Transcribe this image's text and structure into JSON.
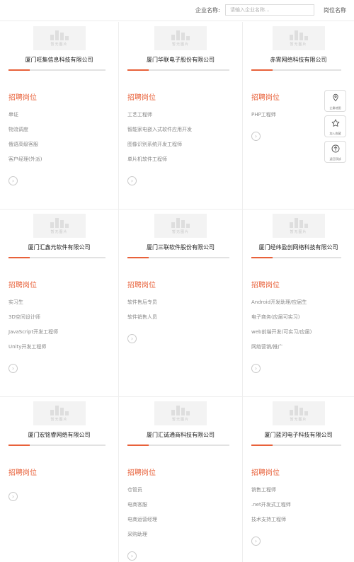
{
  "search": {
    "company_label": "企业名称:",
    "company_placeholder": "请输入企业名称...",
    "position_label": "岗位名称"
  },
  "section_title": "招聘岗位",
  "logo_text": "暂无图片",
  "companies": [
    {
      "name": "厦门旺集信息科技有限公司",
      "jobs": [
        "串证",
        "物流调度",
        "俄语高级客服",
        "客户经理(外派)"
      ]
    },
    {
      "name": "厦门华联电子股份有限公司",
      "jobs": [
        "工艺工程师",
        "智能家电嵌入式软件应用开发",
        "图像识别系统开发工程师",
        "单片机软件工程师"
      ]
    },
    {
      "name": "赤霄网络科技有限公司",
      "jobs": [
        "PHP工程师"
      ]
    },
    {
      "name": "厦门汇鑫元软件有限公司",
      "jobs": [
        "实习生",
        "3D空间设计师",
        "JavaScript开发工程师",
        "Unity开发工程师"
      ]
    },
    {
      "name": "厦门三联软件股份有限公司",
      "jobs": [
        "软件售后专员",
        "软件销售人员"
      ]
    },
    {
      "name": "厦门经纬盈创网络科技有限公司",
      "jobs": [
        "Android开发助理/应届生",
        "电子商务(应届可实习)",
        "web前端开发(可实习/应届)",
        "网络营销/推广"
      ]
    },
    {
      "name": "厦门宏铭睿网络有限公司",
      "jobs": []
    },
    {
      "name": "厦门汇诚通商科技有限公司",
      "jobs": [
        "仓管员",
        "电商客服",
        "电商运营经理",
        "采购助理"
      ]
    },
    {
      "name": "厦门蓝河电子科技有限公司",
      "jobs": [
        "销售工程师",
        ".net开发式工程师",
        "技术支持工程师"
      ]
    }
  ],
  "side_tools": [
    {
      "label": "企業地图",
      "icon": "location-pin-icon"
    },
    {
      "label": "加入收藏",
      "icon": "star-icon"
    },
    {
      "label": "返回顶部",
      "icon": "arrow-up-circle-icon"
    }
  ],
  "colors": {
    "accent": "#e8613a",
    "text": "#333333",
    "muted": "#888888"
  }
}
